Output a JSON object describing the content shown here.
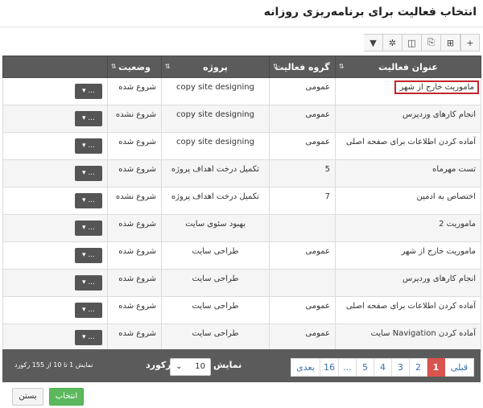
{
  "modal": {
    "title": "انتخاب فعالیت برای برنامه‌ریزی روزانه"
  },
  "toolbar": {
    "icons": [
      "plus-icon",
      "add-box-icon",
      "export-file-icon",
      "columns-icon",
      "gear-icon",
      "filter-icon"
    ],
    "glyphs": [
      "+",
      "⊞",
      "⎘",
      "◫",
      "✲",
      "▼"
    ]
  },
  "grid": {
    "headers": {
      "title": "عنوان فعالیت",
      "group": "گروه فعالیت",
      "project": "پروژه",
      "status": "وضعیت"
    },
    "action_label": "...",
    "rows": [
      {
        "title": "ماموریت خارج از شهر",
        "group": "عمومی",
        "project": "copy site designing",
        "status": "شروع شده",
        "highlighted": true
      },
      {
        "title": "انجام کارهای وردپرس",
        "group": "عمومی",
        "project": "copy site designing",
        "status": "شروع نشده"
      },
      {
        "title": "آماده کردن اطلاعات برای صفحه اصلی",
        "group": "عمومی",
        "project": "copy site designing",
        "status": "شروع شده"
      },
      {
        "title": "تست مهرماه",
        "group": "5",
        "project": "تکمیل درخت اهداف پروژه",
        "status": "شروع شده"
      },
      {
        "title": "اختصاص به ادمین",
        "group": "7",
        "project": "تکمیل درخت اهداف پروژه",
        "status": "شروع نشده"
      },
      {
        "title": "ماموریت 2",
        "group": "",
        "project": "بهبود سئوی سایت",
        "status": "شروع شده"
      },
      {
        "title": "ماموریت خارج از شهر",
        "group": "عمومی",
        "project": "طراحی سایت",
        "status": "شروع شده"
      },
      {
        "title": "انجام کارهای وردپرس",
        "group": "",
        "project": "طراحی سایت",
        "status": "شروع شده"
      },
      {
        "title": "آماده کردن اطلاعات برای صفحه اصلی",
        "group": "عمومی",
        "project": "طراحی سایت",
        "status": "شروع شده"
      },
      {
        "title": "آماده کردن Navigation سایت",
        "group": "عمومی",
        "project": "طراحی سایت",
        "status": "شروع شده"
      }
    ]
  },
  "pager": {
    "prev_label": "قبلی",
    "next_label": "بعدی",
    "pages": [
      "1",
      "2",
      "3",
      "4",
      "5",
      "...",
      "16"
    ],
    "active_page": "1",
    "show_label": "نمایش",
    "page_size": "10",
    "record_label": "رکورد",
    "count_info": "نمایش 1 تا 10 از 155 رکورد"
  },
  "footer": {
    "select_label": "انتخاب",
    "close_label": "بستن"
  },
  "colors": {
    "header_bg": "#5b5b5b",
    "active_page": "#d9534f",
    "highlight_border": "#c0262c",
    "select_button": "#5cb85c"
  }
}
